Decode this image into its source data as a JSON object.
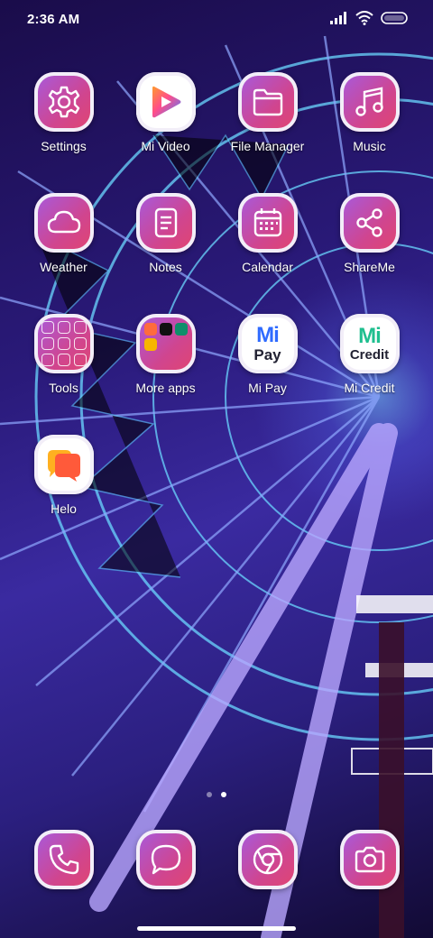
{
  "status_bar": {
    "time": "2:36 AM",
    "icons": [
      "signal-icon",
      "wifi-icon",
      "battery-icon"
    ]
  },
  "apps": [
    {
      "label": "Settings",
      "icon": "gear-icon"
    },
    {
      "label": "Mi Video",
      "icon": "play-icon"
    },
    {
      "label": "File Manager",
      "icon": "folder-icon"
    },
    {
      "label": "Music",
      "icon": "music-note-icon"
    },
    {
      "label": "Weather",
      "icon": "cloud-icon"
    },
    {
      "label": "Notes",
      "icon": "note-icon"
    },
    {
      "label": "Calendar",
      "icon": "calendar-icon"
    },
    {
      "label": "ShareMe",
      "icon": "share-icon"
    },
    {
      "label": "Tools",
      "icon": "tools-folder-icon"
    },
    {
      "label": "More apps",
      "icon": "apps-folder-icon"
    },
    {
      "label": "Mi Pay",
      "icon": "mi-pay-logo",
      "logo_text": [
        "Mi",
        "Pay"
      ]
    },
    {
      "label": "Mi Credit",
      "icon": "mi-credit-logo",
      "logo_text": [
        "Mi",
        "Credit"
      ]
    },
    {
      "label": "Helo",
      "icon": "helo-icon"
    }
  ],
  "dock": [
    {
      "name": "phone",
      "icon": "phone-icon"
    },
    {
      "name": "messaging",
      "icon": "message-bubble-icon"
    },
    {
      "name": "browser",
      "icon": "chrome-icon"
    },
    {
      "name": "camera",
      "icon": "camera-icon"
    }
  ],
  "page_indicator": {
    "pages": 2,
    "active": 1
  },
  "colors": {
    "tile_gradient_start": "#a55be0",
    "tile_gradient_end": "#e2456e",
    "tile_border": "#f2eef8",
    "mi_pay_blue": "#2f6bff",
    "mi_credit_green": "#1fbf8f"
  }
}
